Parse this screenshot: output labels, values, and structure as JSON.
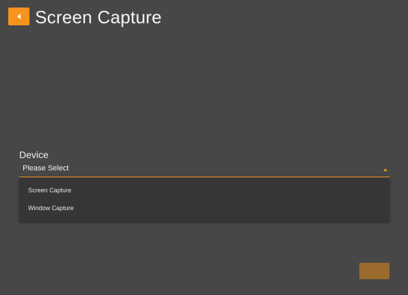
{
  "header": {
    "title": "Screen Capture",
    "back_icon": "chevron-left-icon"
  },
  "colors": {
    "accent": "#f7941d",
    "background": "#474747",
    "dropdown_background": "#363636"
  },
  "device": {
    "label": "Device",
    "selected_value": "Please Select",
    "options": [
      "Screen Capture",
      "Window Capture"
    ],
    "caret_icon": "caret-up-icon"
  }
}
